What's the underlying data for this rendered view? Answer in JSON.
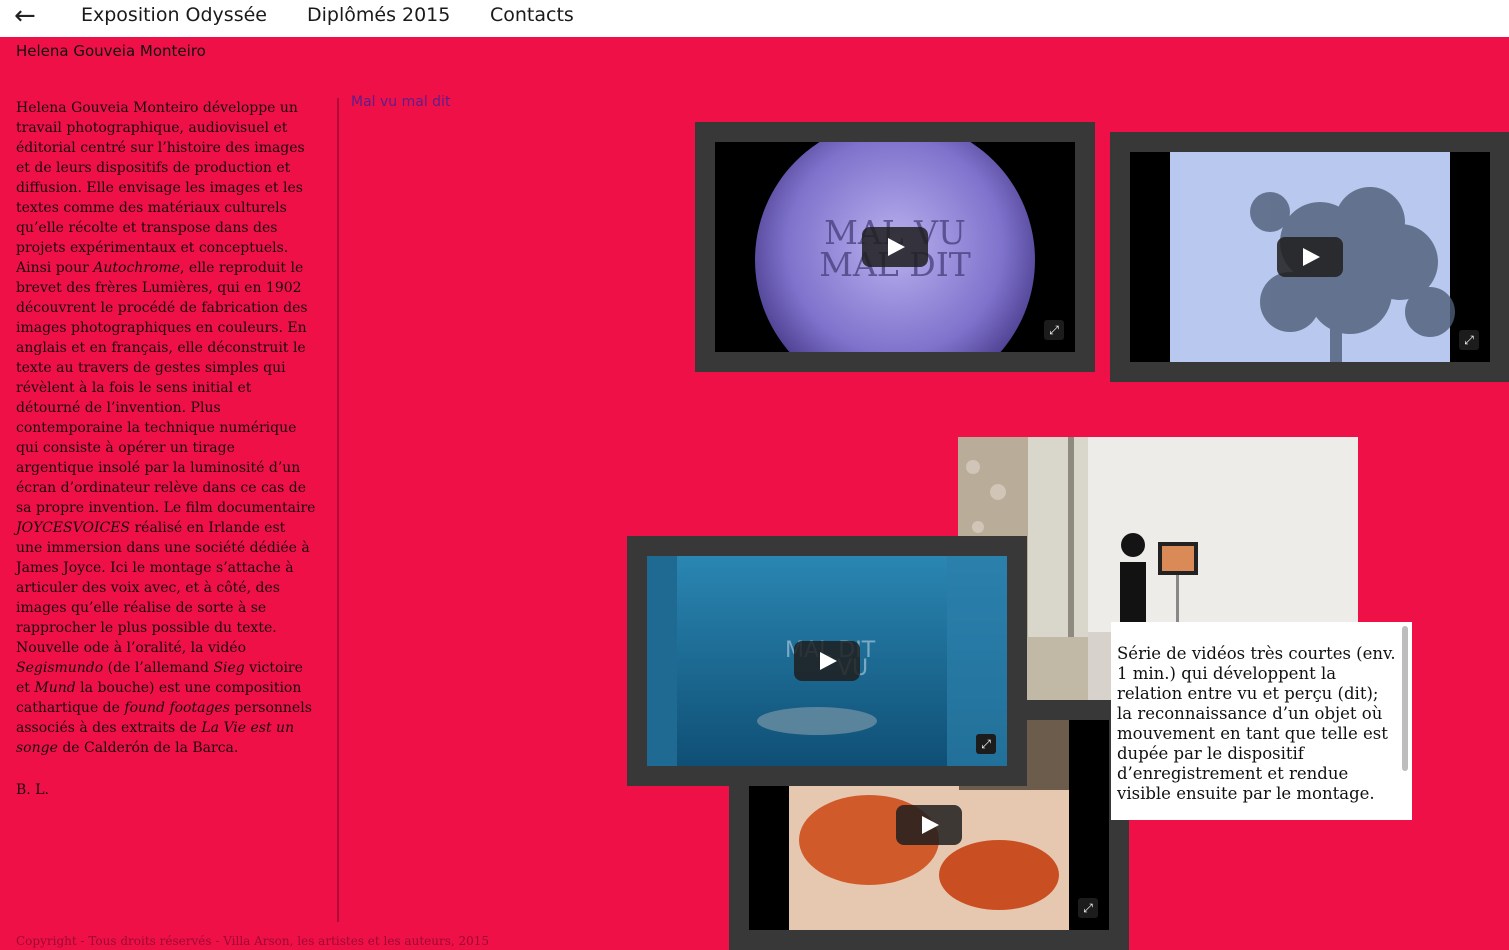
{
  "nav": {
    "back_icon": "left-arrow-icon",
    "items": [
      "Exposition Odyssée",
      "Diplômés 2015",
      "Contacts"
    ]
  },
  "artist": {
    "name": "Helena Gouveia Monteiro"
  },
  "bio": {
    "p1": "Helena Gouveia Monteiro développe un travail photographique, audiovisuel et éditorial centré sur l’histoire des images et de leurs dispositifs de production et diffusion. Elle envisage les images et les textes comme des matériaux culturels qu’elle récolte et transpose dans des projets expérimentaux et conceptuels. Ainsi pour ",
    "t1": "Autochrome",
    "p2": ", elle reproduit le brevet des frères Lumières, qui en 1902 découvrent le procédé de fabrication des images photographiques en couleurs. En anglais et en français, elle déconstruit le texte au travers de gestes simples qui révèlent à la fois le sens initial et détourné de l’invention. Plus contemporaine la technique numérique qui consiste à opérer un tirage argentique insolé par la luminosité d’un écran d’ordinateur relève dans ce cas de sa propre invention. Le film documentaire ",
    "t2": "JOYCESVOICES",
    "p3": " réalisé en Irlande est une immersion dans une société dédiée à James Joyce. Ici le montage s’attache à articuler des voix avec, et à côté, des images qu’elle réalise de sorte à se rapprocher le plus possible du texte. Nouvelle ode à l’oralité, la vidéo ",
    "t3": "Segismundo",
    "p4": " (de l’allemand ",
    "t4": "Sieg",
    "p5": " victoire et ",
    "t5": "Mund",
    "p6": " la bouche) est une composition cathartique de ",
    "t6": "found footages",
    "p7": " personnels associés à des extraits de ",
    "t7": "La Vie est un songe",
    "p8": " de Calderón de la Barca.",
    "signature": "B. L."
  },
  "work": {
    "title": "Mal vu mal dit",
    "video1_overlay": [
      "MAL VU",
      "MAL DIT"
    ],
    "video3_overlay": [
      "MAL DIT",
      "VU"
    ],
    "caption": "Série de vidéos très courtes (env. 1 min.) qui développent la relation entre vu et perçu (dit); la reconnaissance d’un objet où mouvement en tant que telle est dupée par le dispositif d’enregistrement et rendue visible ensuite par le montage."
  },
  "footer": "Copyright - Tous droits réservés - Villa Arson, les artistes et les auteurs, 2015"
}
